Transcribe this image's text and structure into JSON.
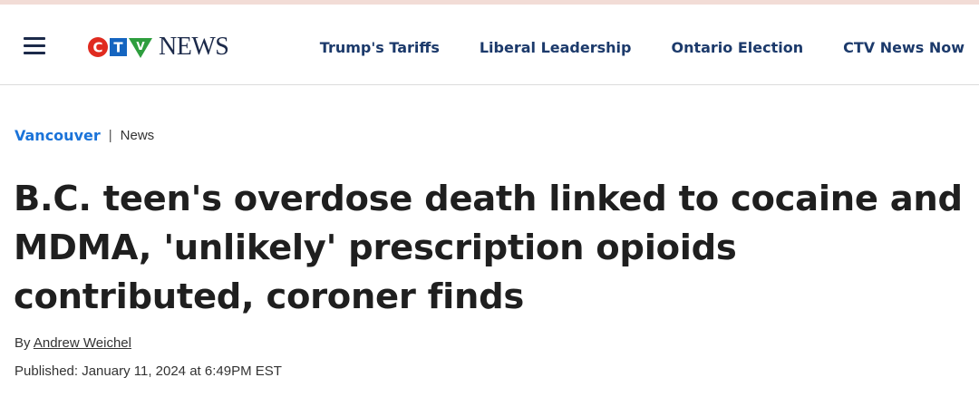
{
  "header": {
    "logo": {
      "letters": [
        "C",
        "T",
        "V"
      ],
      "wordmark": "NEWS"
    },
    "nav": [
      {
        "label": "Trump's Tariffs"
      },
      {
        "label": "Liberal Leadership"
      },
      {
        "label": "Ontario Election"
      },
      {
        "label": "CTV News Now"
      }
    ]
  },
  "breadcrumb": {
    "section": "Vancouver",
    "separator": "|",
    "subsection": "News"
  },
  "article": {
    "headline": "B.C. teen's overdose death linked to cocaine and MDMA, 'unlikely' prescription opioids contributed, coroner finds",
    "byline_prefix": "By",
    "author": "Andrew Weichel",
    "published": "Published: January 11, 2024 at 6:49PM EST"
  },
  "colors": {
    "brand_navy": "#1c2a4a",
    "nav_link": "#1c3a6b",
    "section_link": "#1a73d9",
    "logo_red": "#e02b20",
    "logo_blue": "#1565c0",
    "logo_green": "#2e9e3e"
  },
  "icons": {
    "menu": "hamburger-menu-icon"
  }
}
